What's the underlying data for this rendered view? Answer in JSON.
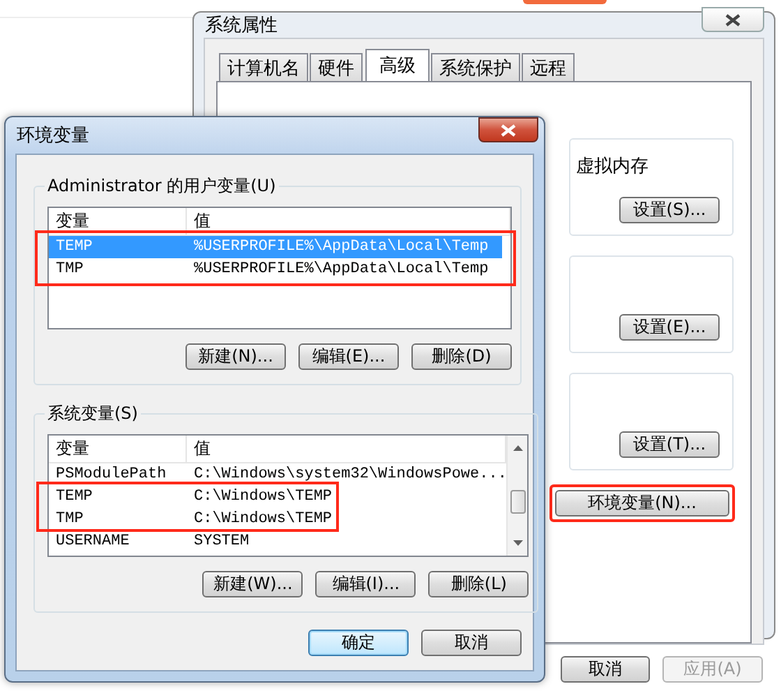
{
  "system_properties": {
    "title": "系统属性",
    "tabs": [
      {
        "label": "计算机名",
        "selected": false
      },
      {
        "label": "硬件",
        "selected": false
      },
      {
        "label": "高级",
        "selected": true
      },
      {
        "label": "系统保护",
        "selected": false
      },
      {
        "label": "远程",
        "selected": false
      }
    ],
    "groups": [
      {
        "text": "虚拟内存",
        "button": "设置(S)..."
      },
      {
        "button": "设置(E)..."
      },
      {
        "button": "设置(T)..."
      }
    ],
    "env_button": {
      "label": "环境变量(N)...",
      "highlighted": true
    },
    "buttons": [
      {
        "label": "取消",
        "disabled": false
      },
      {
        "label": "应用(A)",
        "disabled": true
      }
    ]
  },
  "environment_variables": {
    "title": "环境变量",
    "sections": [
      {
        "title": "Administrator 的用户变量(U)",
        "columns": [
          "变量",
          "值"
        ],
        "scrollbar": false,
        "rows": [
          {
            "name": "TEMP",
            "value": "%USERPROFILE%\\AppData\\Local\\Temp",
            "selected": true,
            "highlighted": true
          },
          {
            "name": "TMP",
            "value": "%USERPROFILE%\\AppData\\Local\\Temp",
            "selected": false,
            "highlighted": true
          }
        ],
        "buttons": [
          "新建(N)...",
          "编辑(E)...",
          "删除(D)"
        ]
      },
      {
        "title": "系统变量(S)",
        "columns": [
          "变量",
          "值"
        ],
        "scrollbar": true,
        "rows": [
          {
            "name": "PSModulePath",
            "value": "C:\\Windows\\system32\\WindowsPowe...",
            "selected": false,
            "highlighted": false
          },
          {
            "name": "TEMP",
            "value": "C:\\Windows\\TEMP",
            "selected": false,
            "highlighted": true
          },
          {
            "name": "TMP",
            "value": "C:\\Windows\\TEMP",
            "selected": false,
            "highlighted": true
          },
          {
            "name": "USERNAME",
            "value": "SYSTEM",
            "selected": false,
            "highlighted": false
          }
        ],
        "buttons": [
          "新建(W)...",
          "编辑(I)...",
          "删除(L)"
        ]
      }
    ],
    "buttons": [
      {
        "label": "确定",
        "default": true
      },
      {
        "label": "取消",
        "default": false
      }
    ]
  }
}
